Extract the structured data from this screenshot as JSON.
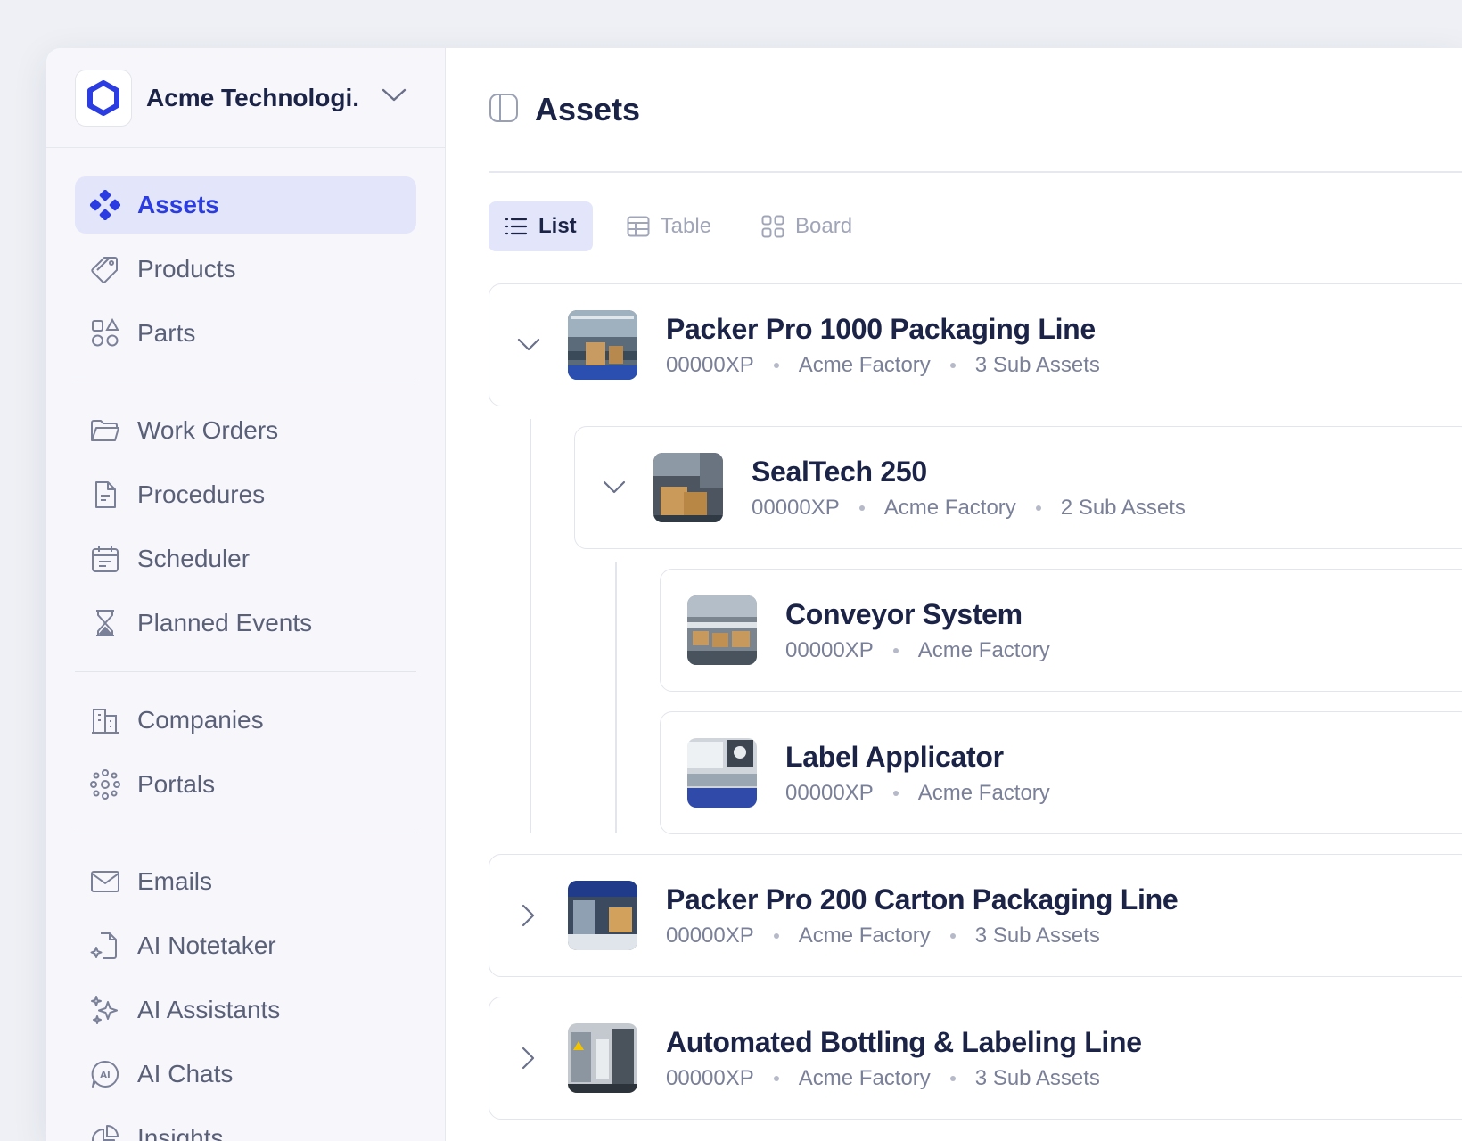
{
  "org": {
    "name": "Acme Technologi..."
  },
  "nav": {
    "group1": [
      {
        "label": "Assets",
        "icon": "assets-icon",
        "active": true
      },
      {
        "label": "Products",
        "icon": "tag-icon"
      },
      {
        "label": "Parts",
        "icon": "parts-icon"
      }
    ],
    "group2": [
      {
        "label": "Work Orders",
        "icon": "folder-icon"
      },
      {
        "label": "Procedures",
        "icon": "document-icon"
      },
      {
        "label": "Scheduler",
        "icon": "calendar-icon"
      },
      {
        "label": "Planned Events",
        "icon": "hourglass-icon"
      }
    ],
    "group3": [
      {
        "label": "Companies",
        "icon": "building-icon"
      },
      {
        "label": "Portals",
        "icon": "network-icon"
      }
    ],
    "group4": [
      {
        "label": "Emails",
        "icon": "mail-icon"
      },
      {
        "label": "AI Notetaker",
        "icon": "ai-note-icon"
      },
      {
        "label": "AI Assistants",
        "icon": "sparkles-icon"
      },
      {
        "label": "AI Chats",
        "icon": "ai-chat-icon"
      },
      {
        "label": "Insights",
        "icon": "pie-chart-icon"
      }
    ]
  },
  "page": {
    "title": "Assets"
  },
  "views": [
    {
      "label": "List",
      "icon": "list-icon",
      "active": true
    },
    {
      "label": "Table",
      "icon": "table-icon"
    },
    {
      "label": "Board",
      "icon": "board-icon"
    }
  ],
  "assets": [
    {
      "title": "Packer Pro 1000 Packaging Line",
      "code": "00000XP",
      "location": "Acme Factory",
      "sub": "3 Sub Assets",
      "expanded": true,
      "level": 0
    },
    {
      "title": "SealTech 250",
      "code": "00000XP",
      "location": "Acme Factory",
      "sub": "2 Sub Assets",
      "expanded": true,
      "level": 1
    },
    {
      "title": "Conveyor System",
      "code": "00000XP",
      "location": "Acme Factory",
      "level": 2
    },
    {
      "title": "Label Applicator",
      "code": "00000XP",
      "location": "Acme Factory",
      "level": 2
    },
    {
      "title": "Packer Pro 200 Carton Packaging Line",
      "code": "00000XP",
      "location": "Acme Factory",
      "sub": "3 Sub Assets",
      "expanded": false,
      "level": 0
    },
    {
      "title": "Automated Bottling & Labeling Line",
      "code": "00000XP",
      "location": "Acme Factory",
      "sub": "3 Sub Assets",
      "expanded": false,
      "level": 0
    }
  ],
  "colors": {
    "accent": "#2b3de0",
    "active_bg": "#e3e6fb",
    "text": "#1b2347",
    "muted": "#7a8098"
  }
}
